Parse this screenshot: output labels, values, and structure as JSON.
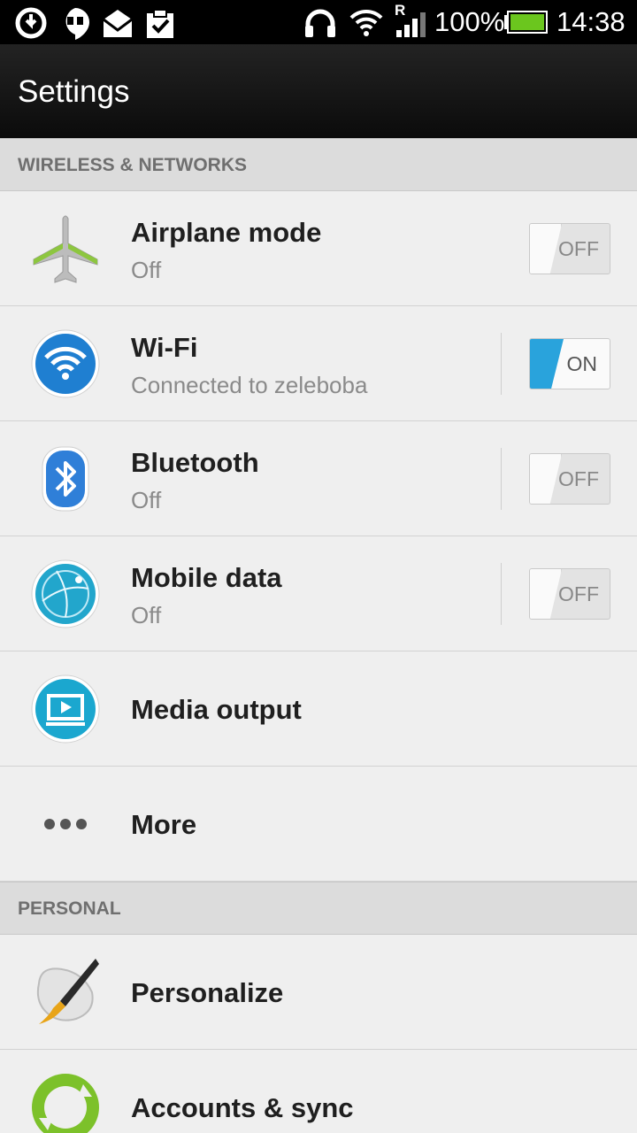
{
  "status_bar": {
    "battery_percent": "100%",
    "time": "14:38",
    "roaming_indicator": "R",
    "icons_left": [
      "sync-icon",
      "hangouts-icon",
      "mail-icon",
      "task-icon"
    ],
    "icons_right": [
      "headset-icon",
      "wifi-icon",
      "signal-icon",
      "battery-icon"
    ]
  },
  "action_bar": {
    "title": "Settings"
  },
  "sections": {
    "wireless": "WIRELESS & NETWORKS",
    "personal": "PERSONAL"
  },
  "items": {
    "airplane": {
      "label": "Airplane mode",
      "sub": "Off",
      "toggle": "OFF",
      "icon": "airplane-icon"
    },
    "wifi": {
      "label": "Wi-Fi",
      "sub": "Connected to zeleboba",
      "toggle": "ON",
      "icon": "wifi-icon"
    },
    "bluetooth": {
      "label": "Bluetooth",
      "sub": "Off",
      "toggle": "OFF",
      "icon": "bluetooth-icon"
    },
    "mobile_data": {
      "label": "Mobile data",
      "sub": "Off",
      "toggle": "OFF",
      "icon": "globe-icon"
    },
    "media_output": {
      "label": "Media output",
      "icon": "screen-icon"
    },
    "more": {
      "label": "More",
      "icon": "more-dots-icon"
    },
    "personalize": {
      "label": "Personalize",
      "icon": "paintbrush-icon"
    },
    "accounts": {
      "label": "Accounts & sync",
      "icon": "sync-arrows-icon"
    }
  },
  "colors": {
    "accent_blue": "#29a3dc",
    "battery_green": "#6bc61e",
    "section_bg": "#dcdcdc",
    "list_bg": "#efefef"
  }
}
